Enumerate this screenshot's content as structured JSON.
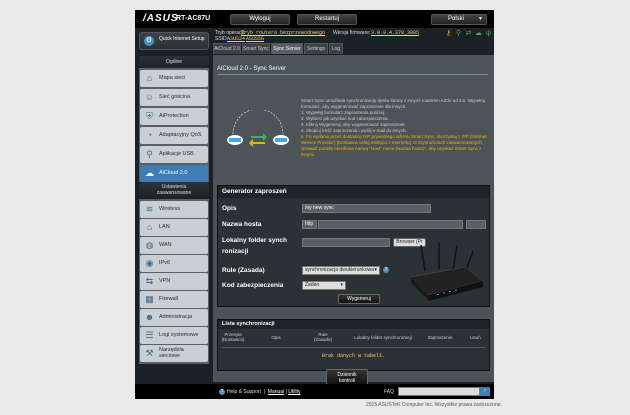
{
  "header": {
    "logo": "/ASUS",
    "model": "RT-AC87U",
    "logout_label": "Wyloguj",
    "restart_label": "Restartuj",
    "language": "Polski"
  },
  "status": {
    "op_mode_label": "Tryb operacji:",
    "op_mode_value": "Tryb routera bezprzewodowego",
    "firmware_label": "Wersja firmware:",
    "firmware_value": "3.0.0.4.378_3885",
    "ssid_label": "SSID:",
    "ssid_1": "ASUS24",
    "ssid_2": "ASUS5G"
  },
  "sidebar": {
    "quick_setup": "Quick Internet Setup",
    "general_title": "Ogólne",
    "general_items": [
      {
        "label": "Mapa sieci",
        "icon": "network-map-icon"
      },
      {
        "label": "Sieć gościna",
        "icon": "guest-network-icon"
      },
      {
        "label": "AiProtection",
        "icon": "aiprotection-icon"
      },
      {
        "label": "Adaptacyjny QoS",
        "icon": "qos-icon"
      },
      {
        "label": "Aplikacje USB",
        "icon": "usb-icon"
      },
      {
        "label": "AiCloud 2.0",
        "icon": "cloud-icon"
      }
    ],
    "advanced_title_1": "Ustawienia",
    "advanced_title_2": "zaawansowane",
    "advanced_items": [
      {
        "label": "Wireless",
        "icon": "wireless-icon"
      },
      {
        "label": "LAN",
        "icon": "lan-icon"
      },
      {
        "label": "WAN",
        "icon": "wan-icon"
      },
      {
        "label": "IPv6",
        "icon": "ipv6-icon"
      },
      {
        "label": "VPN",
        "icon": "vpn-icon"
      },
      {
        "label": "Firewall",
        "icon": "firewall-icon"
      },
      {
        "label": "Administracja",
        "icon": "administration-icon"
      },
      {
        "label": "Logi systemowe",
        "icon": "system-log-icon"
      },
      {
        "label_1": "Narzędzia",
        "label_2": "sieciowe",
        "icon": "network-tools-icon"
      }
    ]
  },
  "tabs": [
    "AiCloud 2.0",
    "Smart Sync",
    "Sync Server",
    "Settings",
    "Log"
  ],
  "content": {
    "title": "AiCloud 2.0 - Sync Server",
    "desc_intro": "Smart Sync umożliwia synchronizację dysku strony z innymi routerem AiClo ud 2.0. Wypełnij formularz, aby wygenerować zaproszenie dla innych.",
    "steps": [
      "1. Wypełnij formularz zaproszenia poniżej.",
      "2. Wybierz jak uzyskać kod zabezpieczenia.",
      "3. Kliknij Wygeneruj, aby wygenerować zaproszenie.",
      "4. Skopiuj treść zaproszenia i wyślij e-mail do innych."
    ],
    "note": "5. Po wydaniu przez dostawcę ISP prywatnego adresu Smart Sync, skorzystaj z ISP (Internet Service Provider) [Dostawca usług dostępu z Internetu]. O czynnościach zaawansowanych, sprawdź poradę określoną nazwą \"Host\" name (Nazwa hosta)\", aby uzyskać Smart Sync z innymi."
  },
  "generator": {
    "title": "Generator zaproszeń",
    "desc_label": "Opis",
    "desc_value": "my new sync",
    "host_label": "Nazwa hosta",
    "host_protocol": "http",
    "local_folder_label_1": "Lokalny folder synch",
    "local_folder_label_2": "ronizacji",
    "browse_label": "Browser (Pr",
    "rule_label": "Rule (Zasada)",
    "rule_value": "synchronizacja dwukierunkowa",
    "security_label": "Kod zabezpieczenia",
    "security_value": "Żaden",
    "generate_label": "Wygeneruj"
  },
  "sync_list": {
    "title": "Lista synchronizacji",
    "columns": [
      {
        "l1": "Przesyła",
        "l2": "(Dostawca)"
      },
      {
        "l1": "Opis",
        "l2": ""
      },
      {
        "l1": "Rule",
        "l2": "(Zasada)"
      },
      {
        "l1": "Lokalny folder synchronizacji",
        "l2": ""
      },
      {
        "l1": "Zaproszenie",
        "l2": ""
      },
      {
        "l1": "Usuń",
        "l2": ""
      }
    ],
    "empty": "Brak danych w tabeli."
  },
  "log_button": {
    "l1": "Dziennik",
    "l2": "kontroli"
  },
  "footer": {
    "help": "Help & Support",
    "manual": "Manual",
    "utility": "Utility",
    "faq": "FAQ",
    "copyright": "2015 ASUSTeK Computer Inc. Wszystkie prawa zastrzeżone."
  }
}
